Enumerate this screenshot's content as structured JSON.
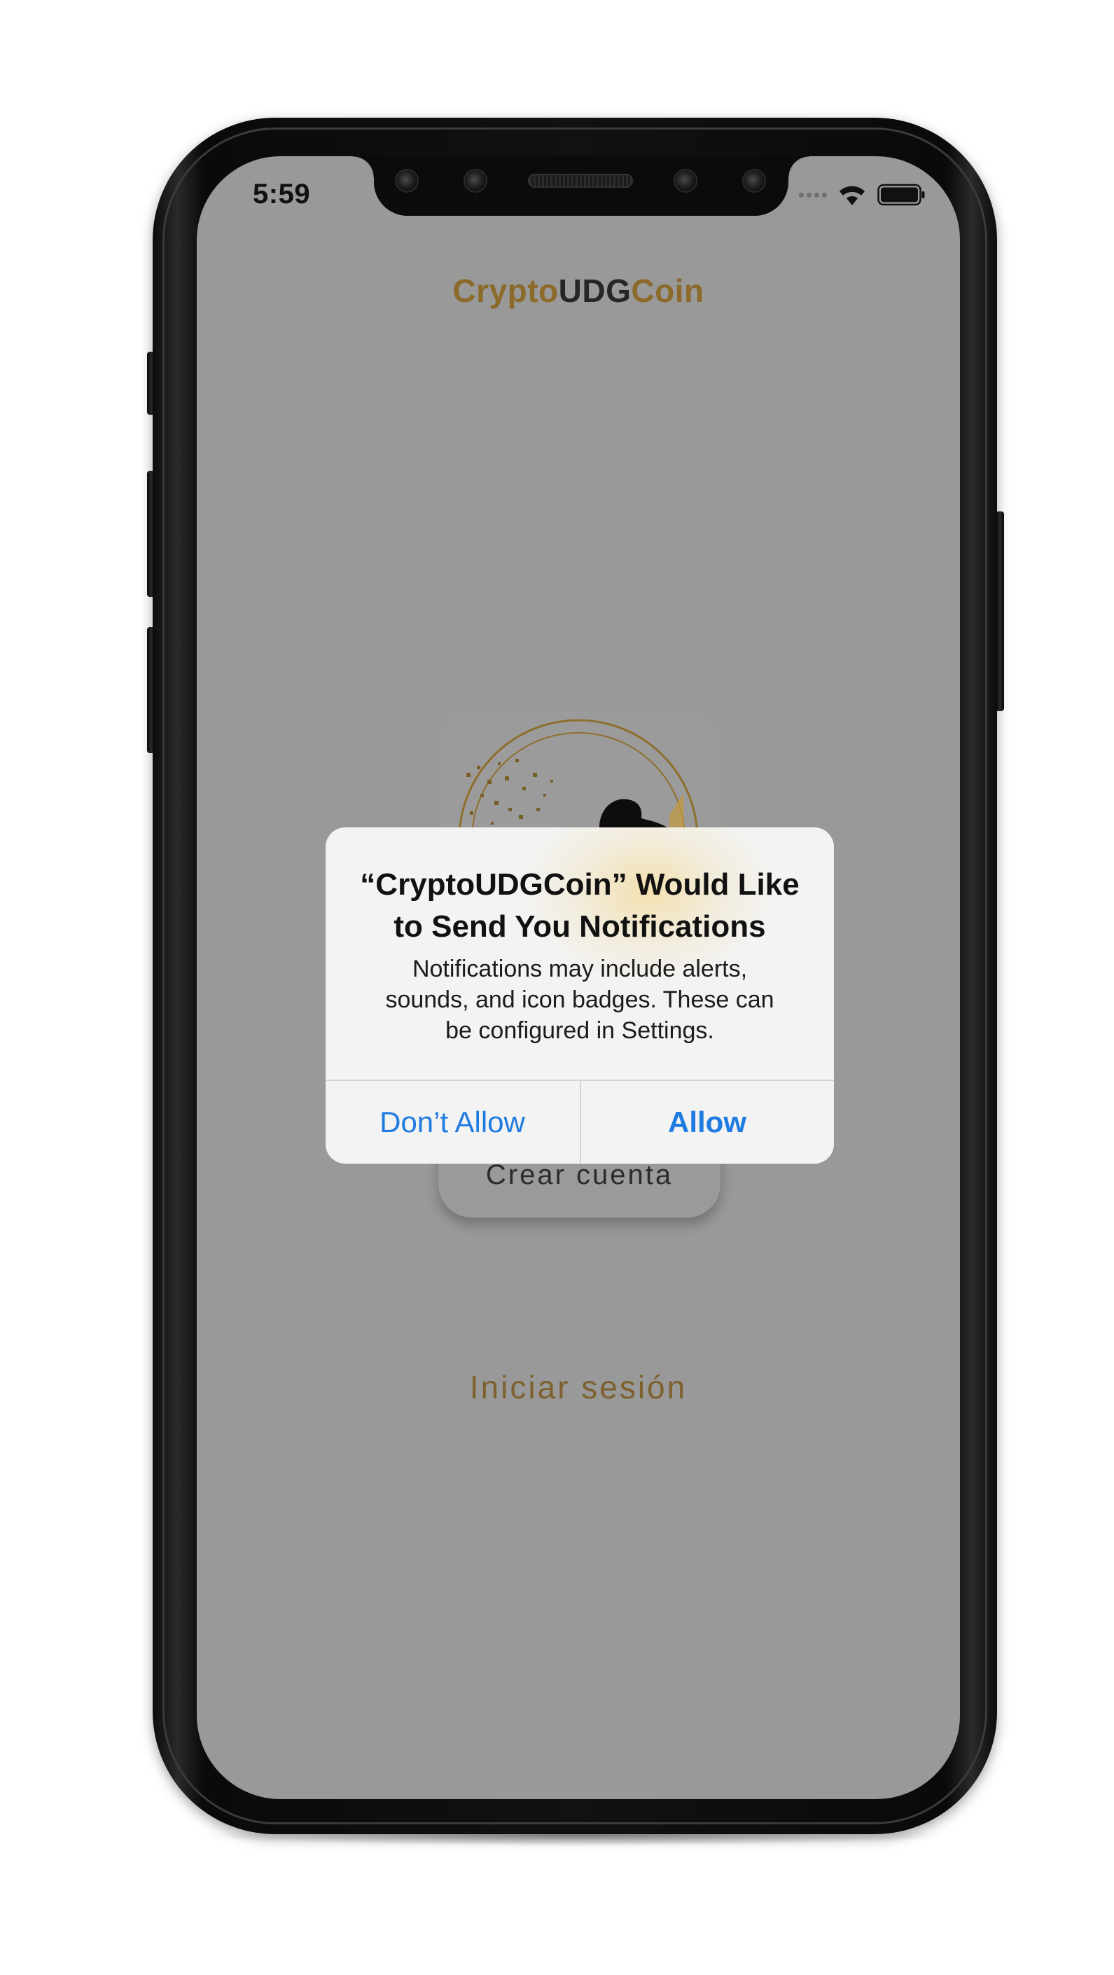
{
  "status_bar": {
    "time": "5:59",
    "icons": [
      "signal-dots-icon",
      "wifi-icon",
      "battery-icon"
    ]
  },
  "app": {
    "title_part1": "Crypto",
    "title_part2": "UDG",
    "title_part3": "Coin",
    "create_account_label": "Crear cuenta",
    "login_label": "Iniciar sesión"
  },
  "alert": {
    "title_line1": "“CryptoUDGCoin” Would Like",
    "title_line2": "to Send You Notifications",
    "message_line1": "Notifications may include alerts,",
    "message_line2": "sounds, and icon badges. These can",
    "message_line3": "be configured in Settings.",
    "deny_label": "Don’t Allow",
    "allow_label": "Allow"
  },
  "colors": {
    "screen_background": "#999999",
    "brand_gold": "#8c6a2a",
    "alert_background": "#f3f3f3",
    "alert_button": "#1f7be0"
  }
}
